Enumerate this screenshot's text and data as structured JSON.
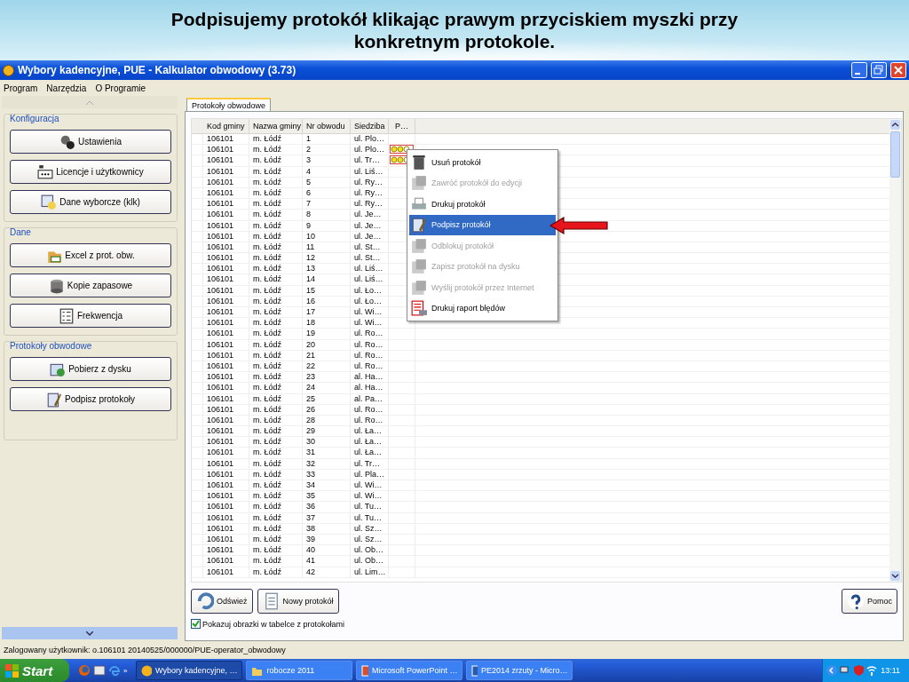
{
  "slide_title": "Podpisujemy protokół klikając prawym przyciskiem myszki przy konkretnym protokole.",
  "window": {
    "title": "Wybory kadencyjne, PUE - Kalkulator obwodowy (3.73)"
  },
  "menu": [
    "Program",
    "Narzędzia",
    "O Programie"
  ],
  "sidebar": {
    "groups": [
      {
        "title": "Konfiguracja",
        "buttons": [
          "Ustawienia",
          "Licencje i użytkownicy",
          "Dane wyborcze (klk)"
        ]
      },
      {
        "title": "Dane",
        "buttons": [
          "Excel z prot. obw.",
          "Kopie zapasowe",
          "Frekwencja"
        ]
      },
      {
        "title": "Protokoły obwodowe",
        "buttons": [
          "Pobierz z dysku",
          "Podpisz protokoły"
        ]
      }
    ]
  },
  "tabs": [
    {
      "label": "Protokoły obwodowe",
      "selected": true
    }
  ],
  "table": {
    "columns": [
      "Kod gminy",
      "Nazwa gminy",
      "Nr obwodu",
      "Siedziba",
      "P…"
    ],
    "rows": [
      {
        "cells": [
          "106101",
          "m. Łódź",
          "1",
          "ul. Plo…"
        ],
        "status_icon": false
      },
      {
        "cells": [
          "106101",
          "m. Łódź",
          "2",
          "ul. Plo…"
        ],
        "status_icon": true
      },
      {
        "cells": [
          "106101",
          "m. Łódź",
          "3",
          "ul. Tr…"
        ],
        "status_icon": true
      },
      {
        "cells": [
          "106101",
          "m. Łódź",
          "4",
          "ul. Liś…"
        ],
        "status_icon": false
      },
      {
        "cells": [
          "106101",
          "m. Łódź",
          "5",
          "ul. Ry…"
        ],
        "status_icon": false
      },
      {
        "cells": [
          "106101",
          "m. Łódź",
          "6",
          "ul. Ry…"
        ],
        "status_icon": false
      },
      {
        "cells": [
          "106101",
          "m. Łódź",
          "7",
          "ul. Ry…"
        ],
        "status_icon": false
      },
      {
        "cells": [
          "106101",
          "m. Łódź",
          "8",
          "ul. Je…"
        ],
        "status_icon": false
      },
      {
        "cells": [
          "106101",
          "m. Łódź",
          "9",
          "ul. Je…"
        ],
        "status_icon": false
      },
      {
        "cells": [
          "106101",
          "m. Łódź",
          "10",
          "ul. Je…"
        ],
        "status_icon": false
      },
      {
        "cells": [
          "106101",
          "m. Łódź",
          "11",
          "ul. St…"
        ],
        "status_icon": false
      },
      {
        "cells": [
          "106101",
          "m. Łódź",
          "12",
          "ul. St…"
        ],
        "status_icon": false
      },
      {
        "cells": [
          "106101",
          "m. Łódź",
          "13",
          "ul. Liś…"
        ],
        "status_icon": false
      },
      {
        "cells": [
          "106101",
          "m. Łódź",
          "14",
          "ul. Liś…"
        ],
        "status_icon": false
      },
      {
        "cells": [
          "106101",
          "m. Łódź",
          "15",
          "ul. Ło…"
        ],
        "status_icon": false
      },
      {
        "cells": [
          "106101",
          "m. Łódź",
          "16",
          "ul. Ło…"
        ],
        "status_icon": false
      },
      {
        "cells": [
          "106101",
          "m. Łódź",
          "17",
          "ul. Wi…"
        ],
        "status_icon": false
      },
      {
        "cells": [
          "106101",
          "m. Łódź",
          "18",
          "ul. Wi…"
        ],
        "status_icon": false
      },
      {
        "cells": [
          "106101",
          "m. Łódź",
          "19",
          "ul. Ro…"
        ],
        "status_icon": false
      },
      {
        "cells": [
          "106101",
          "m. Łódź",
          "20",
          "ul. Ro…"
        ],
        "status_icon": false
      },
      {
        "cells": [
          "106101",
          "m. Łódź",
          "21",
          "ul. Ro…"
        ],
        "status_icon": false
      },
      {
        "cells": [
          "106101",
          "m. Łódź",
          "22",
          "ul. Ro…"
        ],
        "status_icon": false
      },
      {
        "cells": [
          "106101",
          "m. Łódź",
          "23",
          "al. Ha…"
        ],
        "status_icon": false
      },
      {
        "cells": [
          "106101",
          "m. Łódź",
          "24",
          "al. Ha…"
        ],
        "status_icon": false
      },
      {
        "cells": [
          "106101",
          "m. Łódź",
          "25",
          "al. Pa…"
        ],
        "status_icon": false
      },
      {
        "cells": [
          "106101",
          "m. Łódź",
          "26",
          "ul. Ro…"
        ],
        "status_icon": false
      },
      {
        "cells": [
          "106101",
          "m. Łódź",
          "28",
          "ul. Ro…"
        ],
        "status_icon": false
      },
      {
        "cells": [
          "106101",
          "m. Łódź",
          "29",
          "ul. Ła…"
        ],
        "status_icon": false
      },
      {
        "cells": [
          "106101",
          "m. Łódź",
          "30",
          "ul. Ła…"
        ],
        "status_icon": false
      },
      {
        "cells": [
          "106101",
          "m. Łódź",
          "31",
          "ul. Ła…"
        ],
        "status_icon": false
      },
      {
        "cells": [
          "106101",
          "m. Łódź",
          "32",
          "ul. Tr…"
        ],
        "status_icon": false
      },
      {
        "cells": [
          "106101",
          "m. Łódź",
          "33",
          "ul. Pla…"
        ],
        "status_icon": false
      },
      {
        "cells": [
          "106101",
          "m. Łódź",
          "34",
          "ul. Wi…"
        ],
        "status_icon": false
      },
      {
        "cells": [
          "106101",
          "m. Łódź",
          "35",
          "ul. Wi…"
        ],
        "status_icon": false
      },
      {
        "cells": [
          "106101",
          "m. Łódź",
          "36",
          "ul. Tu…"
        ],
        "status_icon": false
      },
      {
        "cells": [
          "106101",
          "m. Łódź",
          "37",
          "ul. Tu…"
        ],
        "status_icon": false
      },
      {
        "cells": [
          "106101",
          "m. Łódź",
          "38",
          "ul. Sz…"
        ],
        "status_icon": false
      },
      {
        "cells": [
          "106101",
          "m. Łódź",
          "39",
          "ul. Sz…"
        ],
        "status_icon": false
      },
      {
        "cells": [
          "106101",
          "m. Łódź",
          "40",
          "ul. Ob…"
        ],
        "status_icon": false
      },
      {
        "cells": [
          "106101",
          "m. Łódź",
          "41",
          "ul. Ob…"
        ],
        "status_icon": false
      },
      {
        "cells": [
          "106101",
          "m. Łódź",
          "42",
          "ul. Lim…"
        ],
        "status_icon": false
      }
    ]
  },
  "context_menu": {
    "items": [
      {
        "label": "Usuń protokół",
        "disabled": false,
        "selected": false
      },
      {
        "label": "Zawróć protokół do edycji",
        "disabled": true,
        "selected": false
      },
      {
        "label": "Drukuj protokół",
        "disabled": false,
        "selected": false
      },
      {
        "label": "Podpisz protokół",
        "disabled": false,
        "selected": true
      },
      {
        "label": "Odblokuj protokół",
        "disabled": true,
        "selected": false
      },
      {
        "label": "Zapisz protokół na dysku",
        "disabled": true,
        "selected": false
      },
      {
        "label": "Wyślij protokół przez Internet",
        "disabled": true,
        "selected": false
      },
      {
        "label": "Drukuj raport błędów",
        "disabled": false,
        "selected": false
      }
    ]
  },
  "buttons": [
    "Odśwież",
    "Nowy protokół"
  ],
  "help_button": "Pomoc",
  "checkbox": {
    "label": "Pokazuj obrazki w tabelce z protokołami",
    "checked": true
  },
  "status_bar": "Zalogowany użytkownik: o.106101 20140525/000000/PUE-operator_obwodowy",
  "taskbar": {
    "start": "Start",
    "quick_launch_more": "»",
    "tasks": [
      {
        "label": "Wybory kadencyjne, …",
        "selected": true
      },
      {
        "label": "robocze 2011",
        "selected": false
      },
      {
        "label": "Microsoft PowerPoint …",
        "selected": false
      },
      {
        "label": "PE2014 zrzuty - Micro…",
        "selected": false
      }
    ],
    "clock": "13:11"
  }
}
